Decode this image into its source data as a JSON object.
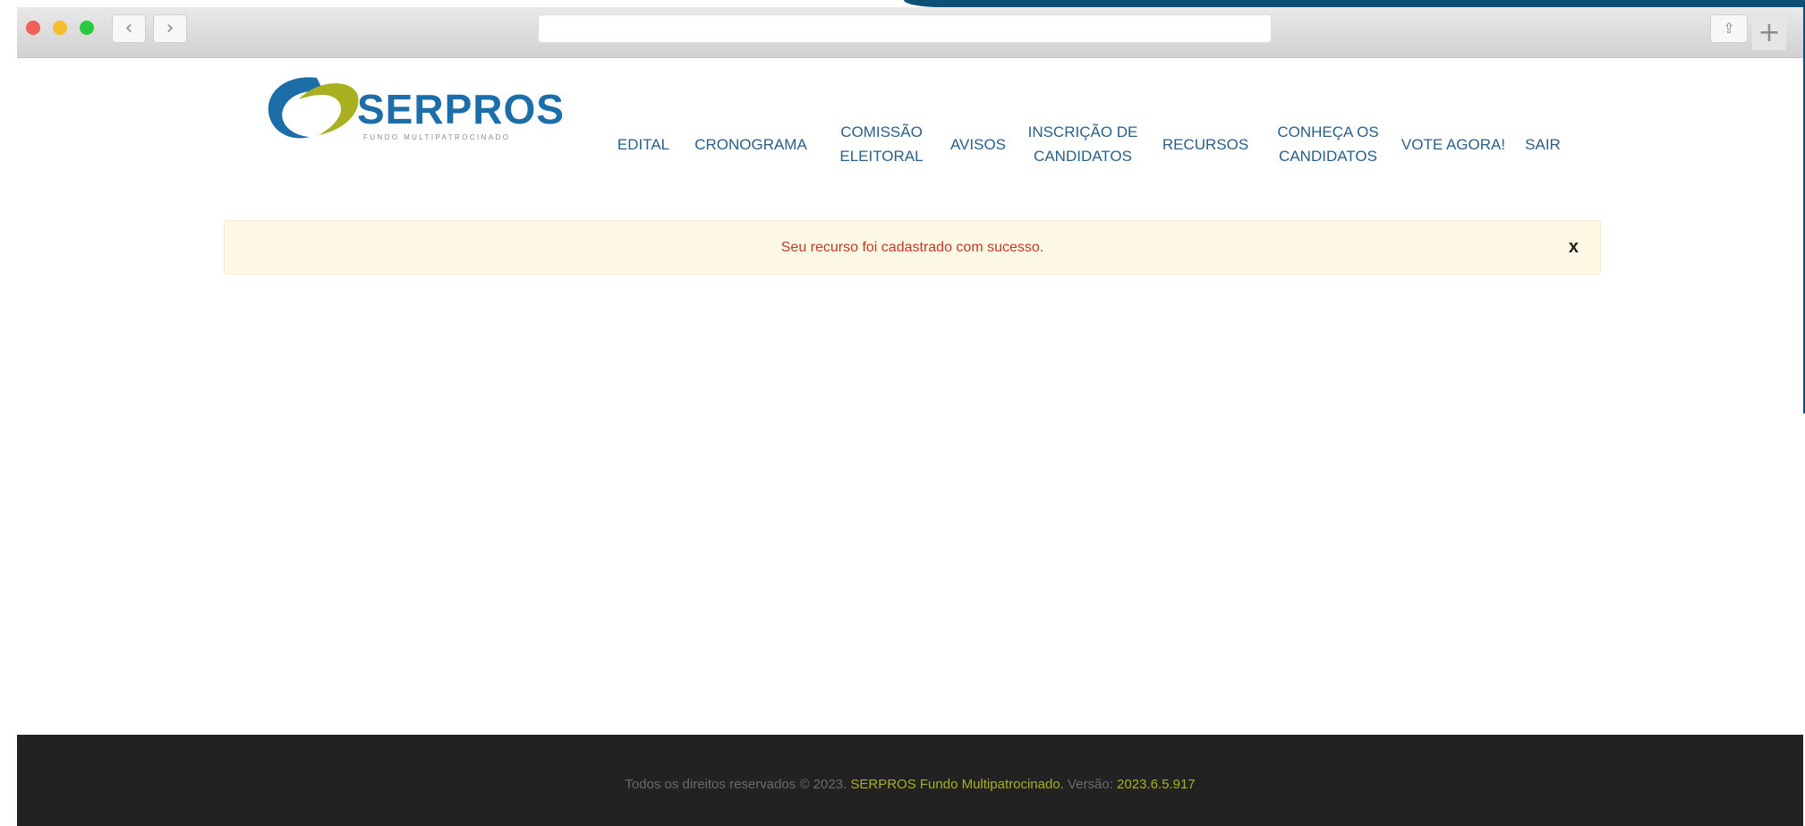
{
  "browser": {
    "back_glyph": "‹",
    "forward_glyph": "›",
    "share_glyph": "⇪",
    "new_tab_glyph": "+",
    "url": ""
  },
  "logo": {
    "brand": "SERPROS",
    "tagline": "FUNDO MULTIPATROCINADO",
    "colors": {
      "primary": "#1b6ea8",
      "accent": "#a8b020"
    }
  },
  "nav": {
    "items": [
      {
        "line1": "EDITAL",
        "line2": ""
      },
      {
        "line1": "CRONOGRAMA",
        "line2": ""
      },
      {
        "line1": "COMISSÃO",
        "line2": "ELEITORAL"
      },
      {
        "line1": "AVISOS",
        "line2": ""
      },
      {
        "line1": "INSCRIÇÃO DE",
        "line2": "CANDIDATOS"
      },
      {
        "line1": "RECURSOS",
        "line2": ""
      },
      {
        "line1": "CONHEÇA OS",
        "line2": "CANDIDATOS"
      },
      {
        "line1": "VOTE AGORA!",
        "line2": ""
      },
      {
        "line1": "SAIR",
        "line2": ""
      }
    ]
  },
  "alert": {
    "message": "Seu recurso foi cadastrado com sucesso.",
    "close_label": "x"
  },
  "footer": {
    "prefix": "Todos os direitos reservados © 2023.",
    "org": "SERPROS Fundo Multipatrocinado.",
    "version_label": "Versão:",
    "version": "2023.6.5.917"
  }
}
